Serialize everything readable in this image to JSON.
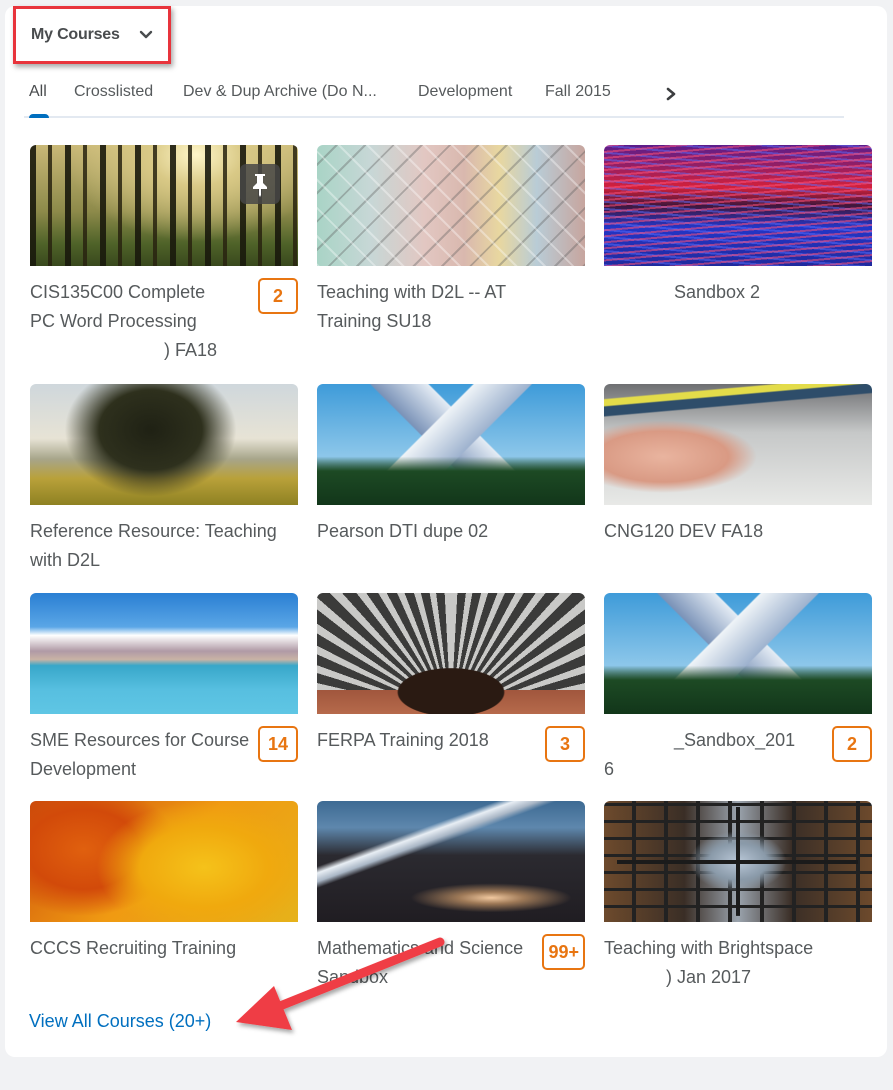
{
  "widget": {
    "title": "My Courses",
    "view_all_label": "View All Courses (20+)"
  },
  "tabs": [
    {
      "label": "All",
      "active": true
    },
    {
      "label": "Crosslisted",
      "active": false
    },
    {
      "label": "Dev & Dup Archive (Do N...",
      "active": false
    },
    {
      "label": "Development",
      "active": false
    },
    {
      "label": "Fall 2015",
      "active": false
    }
  ],
  "icons": {
    "dropdown": "chevron-down-icon",
    "tabs_next": "chevron-right-icon",
    "pin": "pin-icon"
  },
  "courses": [
    {
      "title": "CIS135C00 Complete PC Word Processing ) FA18",
      "title_lines": [
        "CIS135C00 Complete",
        "PC Word Processing",
        ") FA18"
      ],
      "badge": "2",
      "pinned": true,
      "image": "forest"
    },
    {
      "title": "Teaching with D2L -- AT Training SU18",
      "badge": "",
      "pinned": false,
      "image": "colored-tiles"
    },
    {
      "title": "Sandbox 2",
      "badge": "",
      "pinned": false,
      "image": "light-trails"
    },
    {
      "title": "Reference Resource: Teaching with D2L",
      "badge": "",
      "pinned": false,
      "image": "tree-meadow"
    },
    {
      "title": "Pearson DTI dupe 02",
      "badge": "",
      "pinned": false,
      "image": "snowy-mountain"
    },
    {
      "title": "CNG120 DEV FA18",
      "badge": "",
      "pinned": false,
      "image": "network-cables"
    },
    {
      "title": "SME Resources for Course Development",
      "badge": "14",
      "pinned": false,
      "image": "sea-mountains"
    },
    {
      "title": "FERPA Training 2018",
      "badge": "3",
      "pinned": false,
      "image": "tunnel-arch"
    },
    {
      "title": "_Sandbox_2016",
      "title_lines": [
        "_Sandbox_201",
        "6"
      ],
      "badge": "2",
      "pinned": false,
      "image": "snowy-mountain"
    },
    {
      "title": "CCCS Recruiting Training",
      "badge": "",
      "pinned": false,
      "image": "autumn-leaves"
    },
    {
      "title": "Mathematics and Science Sandbox",
      "badge": "99+",
      "pinned": false,
      "image": "mountain-road"
    },
    {
      "title": "Teaching with Brightspace Jan 2017",
      "title_lines": [
        "Teaching with Brightspace",
        ") Jan 2017"
      ],
      "badge": "",
      "pinned": false,
      "image": "metal-structure"
    }
  ],
  "colors": {
    "highlight_box": "#e8343c",
    "badge": "#e87511",
    "link": "#006fbf",
    "tab_indicator": "#006fbf"
  }
}
